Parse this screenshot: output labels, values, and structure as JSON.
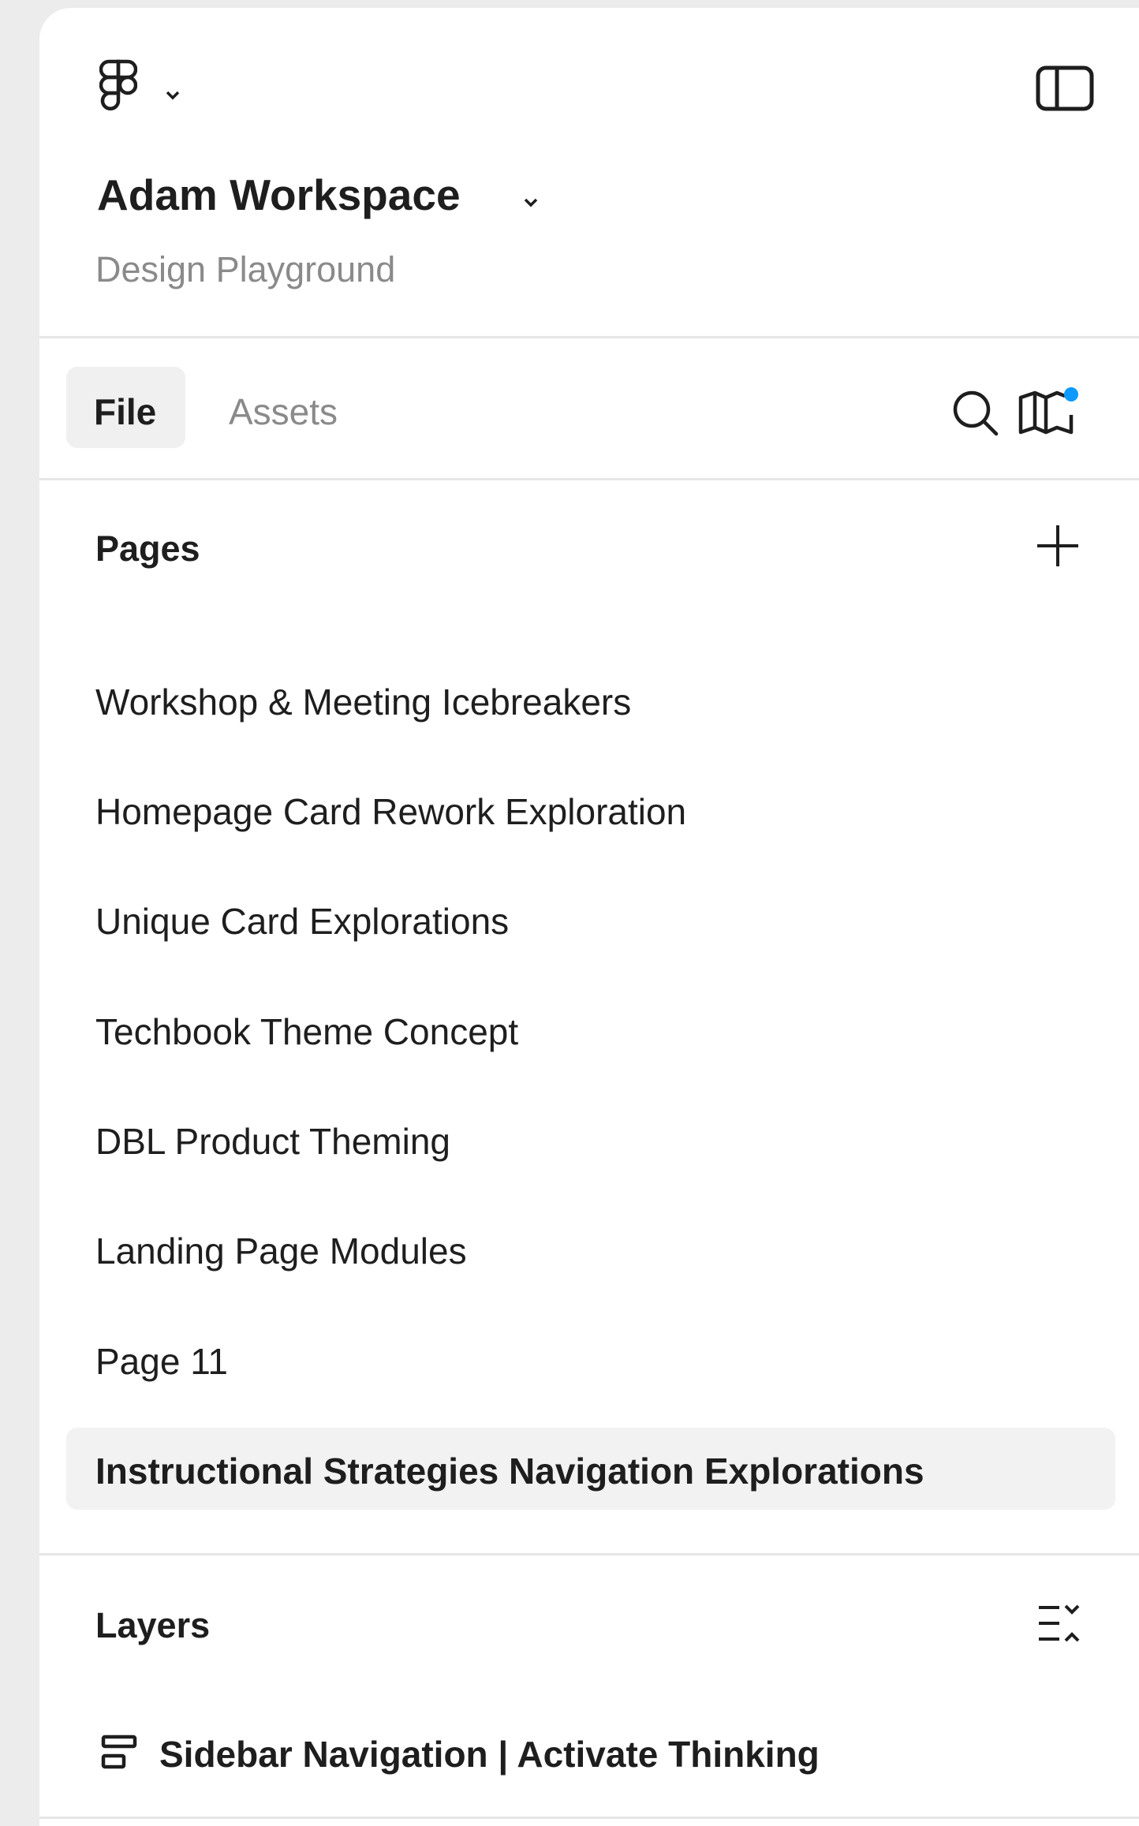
{
  "header": {
    "workspace_name": "Adam Workspace",
    "project_name": "Design Playground",
    "icons": [
      "figma-logo-icon",
      "chevron-down-icon",
      "sidebar-toggle-icon"
    ]
  },
  "tabs": {
    "file_label": "File",
    "assets_label": "Assets",
    "active": "File",
    "icons": [
      "search-icon",
      "library-icon"
    ],
    "notification_dot_color": "#0d99ff"
  },
  "pages": {
    "title": "Pages",
    "add_icon": "plus-icon",
    "items": [
      {
        "label": "Workshop & Meeting Icebreakers",
        "selected": false
      },
      {
        "label": "Homepage Card Rework Exploration",
        "selected": false
      },
      {
        "label": "Unique Card Explorations",
        "selected": false
      },
      {
        "label": "Techbook Theme Concept",
        "selected": false
      },
      {
        "label": "DBL Product Theming",
        "selected": false
      },
      {
        "label": "Landing Page Modules",
        "selected": false
      },
      {
        "label": "Page 11",
        "selected": false
      },
      {
        "label": "Instructional Strategies Navigation Explorations",
        "selected": true
      }
    ]
  },
  "layers": {
    "title": "Layers",
    "collapse_icon": "collapse-layers-icon",
    "items": [
      {
        "label": "Sidebar Navigation | Activate Thinking",
        "icon": "frame-layout-icon"
      }
    ]
  }
}
